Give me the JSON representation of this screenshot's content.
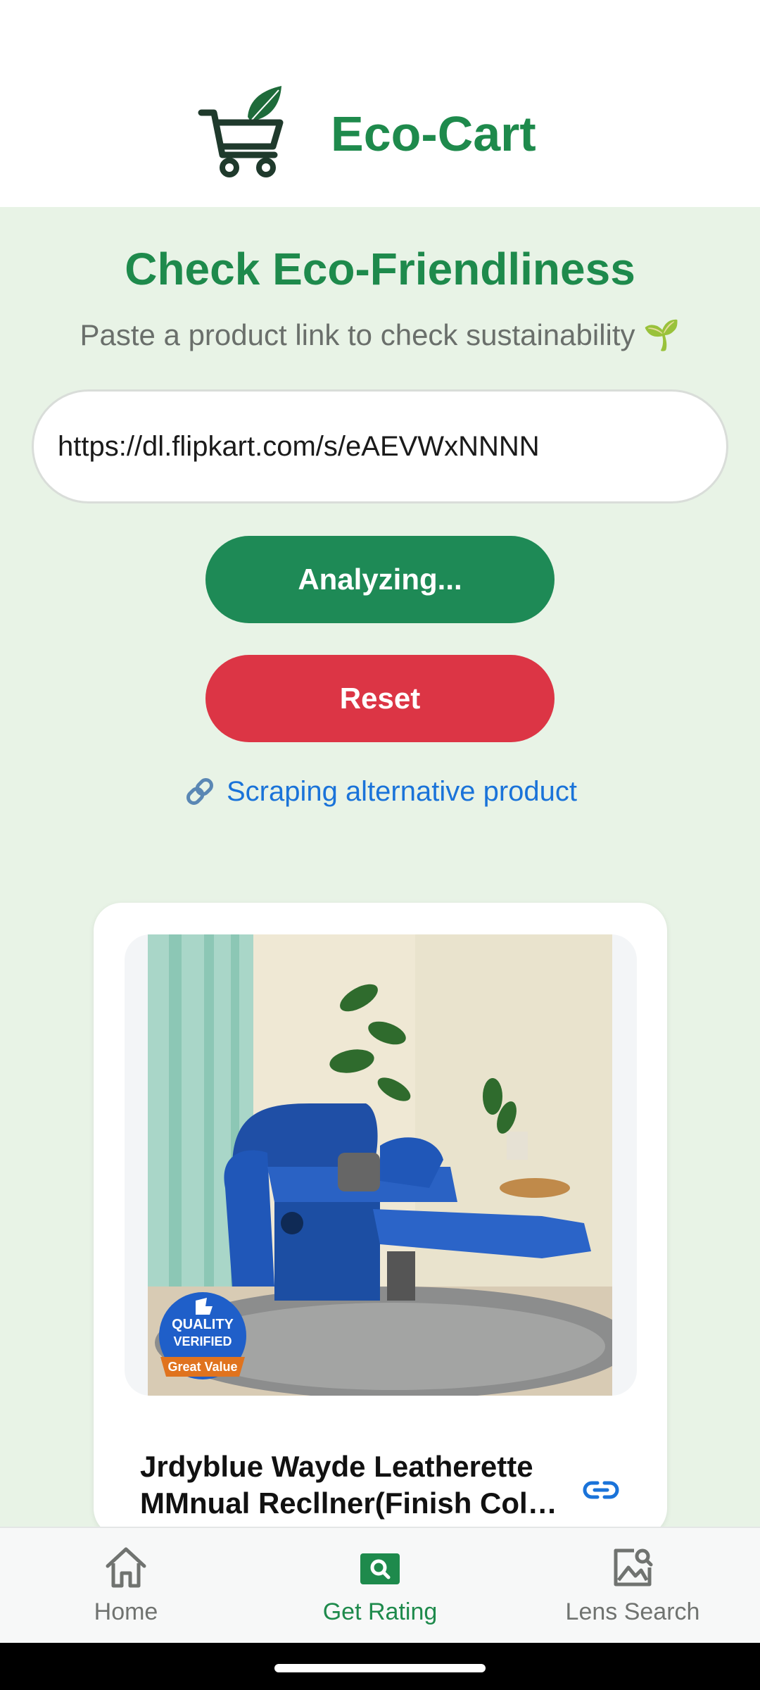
{
  "app": {
    "title": "Eco-Cart",
    "logo_icon": "cart-leaf-icon",
    "brand_color": "#1e8a4c"
  },
  "checker": {
    "heading": "Check Eco-Friendliness",
    "subheading": "Paste a product link to check sustainability 🌱",
    "url_value": "https://dl.flipkart.com/s/eAEVWxNNNN",
    "analyze_label": "Analyzing...",
    "reset_label": "Reset",
    "status_text": "Scraping alternative product",
    "status_icon": "link-icon"
  },
  "product": {
    "image_icon": "product-photo",
    "badge_lines": [
      "QUALITY",
      "VERIFIED",
      "Great Value"
    ],
    "title_line1": "Jrdyblue Wayde Leatherette",
    "title_line2": "MMnual Recllner(Finish Col…",
    "open_link_icon": "chain-link-icon"
  },
  "nav": {
    "items": [
      {
        "label": "Home",
        "icon": "home-icon",
        "active": false
      },
      {
        "label": "Get Rating",
        "icon": "search-image-icon",
        "active": true
      },
      {
        "label": "Lens Search",
        "icon": "lens-search-icon",
        "active": false
      }
    ]
  }
}
